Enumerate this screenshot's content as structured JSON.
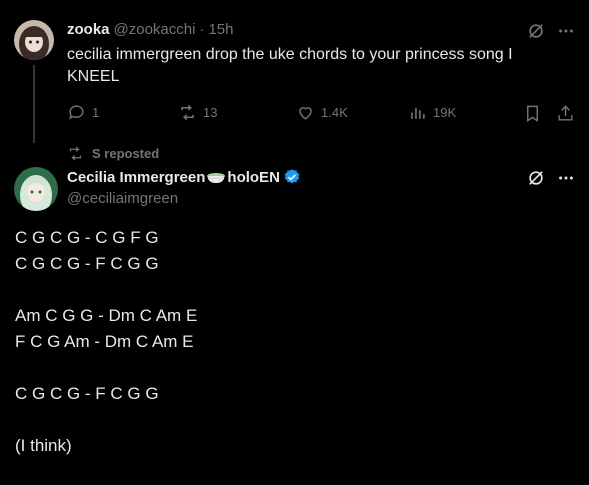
{
  "reply_tweet": {
    "display_name": "zooka",
    "handle": "@zookacchi",
    "separator": "·",
    "time": "15h",
    "text_line1": "cecilia immergreen drop the uke chords to your princess song I",
    "text_line2": "KNEEL",
    "actions": {
      "replies": "1",
      "reposts": "13",
      "likes": "1.4K",
      "views": "19K"
    }
  },
  "repost_label": "S reposted",
  "main_tweet": {
    "display_name": "Cecilia Immergreen",
    "name_suffix": "holoEN",
    "handle": "@ceciliaimgreen",
    "verified": true,
    "lines": [
      "C G C G - C G F G",
      "C G C G - F C G G",
      "",
      "Am C G G - Dm C Am E",
      "F C G Am - Dm C Am E",
      "",
      "C G C G - F C G G",
      "",
      "(I think)"
    ]
  },
  "colors": {
    "background": "#000000",
    "text": "#e7e9ea",
    "muted": "#71767b",
    "verified": "#1d9bf0"
  }
}
